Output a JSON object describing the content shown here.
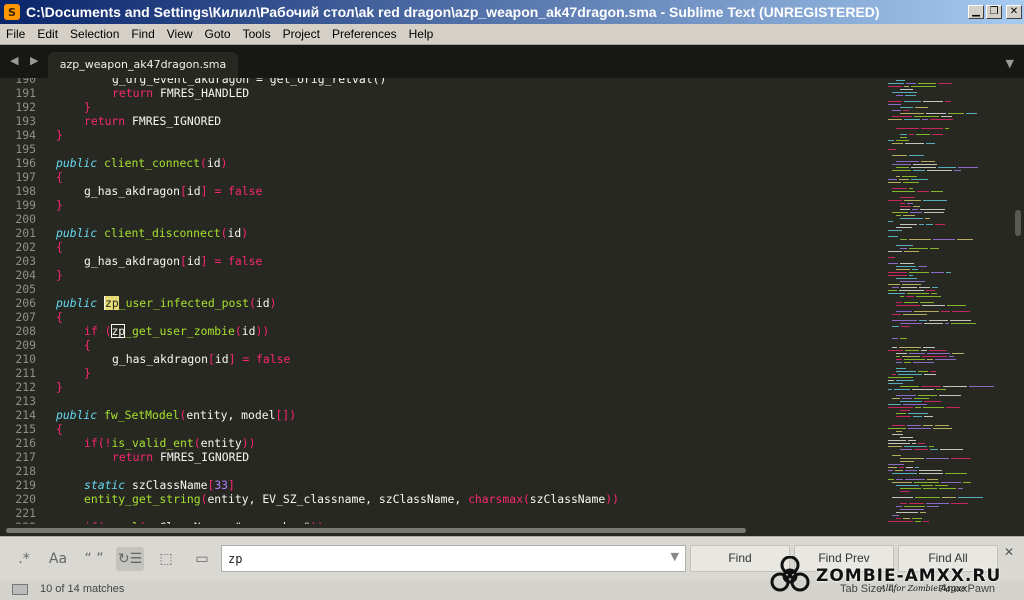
{
  "window": {
    "title": "C:\\Documents and Settings\\Килил\\Рабочий стол\\ak red dragon\\azp_weapon_ak47dragon.sma - Sublime Text (UNREGISTERED)",
    "app_icon_glyph": "S",
    "buttons": {
      "minimize": "▁",
      "maximize": "❐",
      "close": "✕"
    }
  },
  "menu": [
    "File",
    "Edit",
    "Selection",
    "Find",
    "View",
    "Goto",
    "Tools",
    "Project",
    "Preferences",
    "Help"
  ],
  "tabbar": {
    "nav_glyphs": "◀ ▶",
    "active_tab": "azp_weapon_ak47dragon.sma",
    "dropdown_glyph": "▼"
  },
  "editor": {
    "lines": [
      {
        "n": "190",
        "i": 2,
        "s": [
          [
            "p",
            "g_drg_event_akdragon = get_orig_retval()"
          ]
        ]
      },
      {
        "n": "191",
        "i": 2,
        "s": [
          [
            "k",
            "return"
          ],
          [
            "p",
            " FMRES_HANDLED"
          ]
        ]
      },
      {
        "n": "192",
        "i": 1,
        "s": [
          [
            "b",
            "}"
          ]
        ]
      },
      {
        "n": "193",
        "i": 1,
        "s": [
          [
            "k",
            "return"
          ],
          [
            "p",
            " FMRES_IGNORED"
          ]
        ]
      },
      {
        "n": "194",
        "i": 0,
        "s": [
          [
            "b",
            "}"
          ]
        ]
      },
      {
        "n": "195",
        "i": 0,
        "s": []
      },
      {
        "n": "196",
        "i": 0,
        "s": [
          [
            "s",
            "public"
          ],
          [
            "p",
            " "
          ],
          [
            "f",
            "client_connect"
          ],
          [
            "b",
            "("
          ],
          [
            "p",
            "id"
          ],
          [
            "b",
            ")"
          ]
        ]
      },
      {
        "n": "197",
        "i": 0,
        "s": [
          [
            "b",
            "{"
          ]
        ]
      },
      {
        "n": "198",
        "i": 1,
        "s": [
          [
            "p",
            "g_has_akdragon"
          ],
          [
            "b",
            "["
          ],
          [
            "p",
            "id"
          ],
          [
            "b",
            "]"
          ],
          [
            "p",
            " "
          ],
          [
            "k",
            "="
          ],
          [
            "p",
            " "
          ],
          [
            "k",
            "false"
          ]
        ]
      },
      {
        "n": "199",
        "i": 0,
        "s": [
          [
            "b",
            "}"
          ]
        ]
      },
      {
        "n": "200",
        "i": 0,
        "s": []
      },
      {
        "n": "201",
        "i": 0,
        "s": [
          [
            "s",
            "public"
          ],
          [
            "p",
            " "
          ],
          [
            "f",
            "client_disconnect"
          ],
          [
            "b",
            "("
          ],
          [
            "p",
            "id"
          ],
          [
            "b",
            ")"
          ]
        ]
      },
      {
        "n": "202",
        "i": 0,
        "s": [
          [
            "b",
            "{"
          ]
        ]
      },
      {
        "n": "203",
        "i": 1,
        "s": [
          [
            "p",
            "g_has_akdragon"
          ],
          [
            "b",
            "["
          ],
          [
            "p",
            "id"
          ],
          [
            "b",
            "]"
          ],
          [
            "p",
            " "
          ],
          [
            "k",
            "="
          ],
          [
            "p",
            " "
          ],
          [
            "k",
            "false"
          ]
        ]
      },
      {
        "n": "204",
        "i": 0,
        "s": [
          [
            "b",
            "}"
          ]
        ]
      },
      {
        "n": "205",
        "i": 0,
        "s": []
      },
      {
        "n": "206",
        "i": 0,
        "s": [
          [
            "s",
            "public"
          ],
          [
            "p",
            " "
          ],
          [
            "h",
            "zp"
          ],
          [
            "f",
            "_user_infected_post"
          ],
          [
            "b",
            "("
          ],
          [
            "p",
            "id"
          ],
          [
            "b",
            ")"
          ]
        ]
      },
      {
        "n": "207",
        "i": 0,
        "s": [
          [
            "b",
            "{"
          ]
        ]
      },
      {
        "n": "208",
        "i": 1,
        "s": [
          [
            "k",
            "if"
          ],
          [
            "p",
            " "
          ],
          [
            "b",
            "("
          ],
          [
            "hb",
            "zp"
          ],
          [
            "f",
            "_get_user_zombie"
          ],
          [
            "b",
            "("
          ],
          [
            "p",
            "id"
          ],
          [
            "b",
            "))"
          ]
        ]
      },
      {
        "n": "209",
        "i": 1,
        "s": [
          [
            "b",
            "{"
          ]
        ]
      },
      {
        "n": "210",
        "i": 2,
        "s": [
          [
            "p",
            "g_has_akdragon"
          ],
          [
            "b",
            "["
          ],
          [
            "p",
            "id"
          ],
          [
            "b",
            "]"
          ],
          [
            "p",
            " "
          ],
          [
            "k",
            "="
          ],
          [
            "p",
            " "
          ],
          [
            "k",
            "false"
          ]
        ]
      },
      {
        "n": "211",
        "i": 1,
        "s": [
          [
            "b",
            "}"
          ]
        ]
      },
      {
        "n": "212",
        "i": 0,
        "s": [
          [
            "b",
            "}"
          ]
        ]
      },
      {
        "n": "213",
        "i": 0,
        "s": []
      },
      {
        "n": "214",
        "i": 0,
        "s": [
          [
            "s",
            "public"
          ],
          [
            "p",
            " "
          ],
          [
            "f",
            "fw_SetModel"
          ],
          [
            "b",
            "("
          ],
          [
            "p",
            "entity, model"
          ],
          [
            "b",
            "[]"
          ],
          [
            "b",
            ")"
          ]
        ]
      },
      {
        "n": "215",
        "i": 0,
        "s": [
          [
            "b",
            "{"
          ]
        ]
      },
      {
        "n": "216",
        "i": 1,
        "s": [
          [
            "k",
            "if"
          ],
          [
            "b",
            "(!"
          ],
          [
            "f",
            "is_valid_ent"
          ],
          [
            "b",
            "("
          ],
          [
            "p",
            "entity"
          ],
          [
            "b",
            "))"
          ]
        ]
      },
      {
        "n": "217",
        "i": 2,
        "s": [
          [
            "k",
            "return"
          ],
          [
            "p",
            " FMRES_IGNORED"
          ]
        ]
      },
      {
        "n": "218",
        "i": 0,
        "s": []
      },
      {
        "n": "219",
        "i": 1,
        "s": [
          [
            "s",
            "static"
          ],
          [
            "p",
            " szClassName"
          ],
          [
            "b",
            "["
          ],
          [
            "c",
            "33"
          ],
          [
            "b",
            "]"
          ]
        ]
      },
      {
        "n": "220",
        "i": 1,
        "s": [
          [
            "f",
            "entity_get_string"
          ],
          [
            "b",
            "("
          ],
          [
            "p",
            "entity, EV_SZ_classname, szClassName, "
          ],
          [
            "k",
            "charsmax"
          ],
          [
            "b",
            "("
          ],
          [
            "p",
            "szClassName"
          ],
          [
            "b",
            "))"
          ]
        ]
      },
      {
        "n": "221",
        "i": 0,
        "s": []
      },
      {
        "n": "222",
        "i": 1,
        "s": [
          [
            "k",
            "if"
          ],
          [
            "b",
            "("
          ],
          [
            "f",
            "equal"
          ],
          [
            "b",
            "("
          ],
          [
            "p",
            "szClassName, "
          ],
          [
            "p",
            "\"weaponbox\""
          ],
          [
            "b",
            "))"
          ]
        ]
      }
    ]
  },
  "find_panel": {
    "options": [
      {
        "label": ".*",
        "name": "regex-toggle"
      },
      {
        "label": "Aa",
        "name": "case-sensitive-toggle"
      },
      {
        "label": "“ ”",
        "name": "whole-word-toggle"
      },
      {
        "label": "↻☰",
        "name": "wrap-toggle"
      },
      {
        "label": "⬚",
        "name": "in-selection-toggle"
      },
      {
        "label": "▭",
        "name": "highlight-matches-toggle"
      }
    ],
    "query": "zp",
    "history_glyph": "▼",
    "find_label": "Find",
    "find_prev_label": "Find Prev",
    "find_all_label": "Find All",
    "close_glyph": "✕"
  },
  "status": {
    "matches": "10 of 14 matches",
    "tab_size": "Tab Size: 4",
    "syntax": "AmxxPawn"
  },
  "watermark": {
    "brand": "ZOMBIE-AMXX.RU",
    "tagline": "All for ZombiePlague"
  },
  "colors": {
    "background": "#272822",
    "keyword": "#f92672",
    "storage": "#66d9ef",
    "function": "#a6e22e",
    "number": "#ae81ff",
    "match_highlight": "#e6db74"
  }
}
